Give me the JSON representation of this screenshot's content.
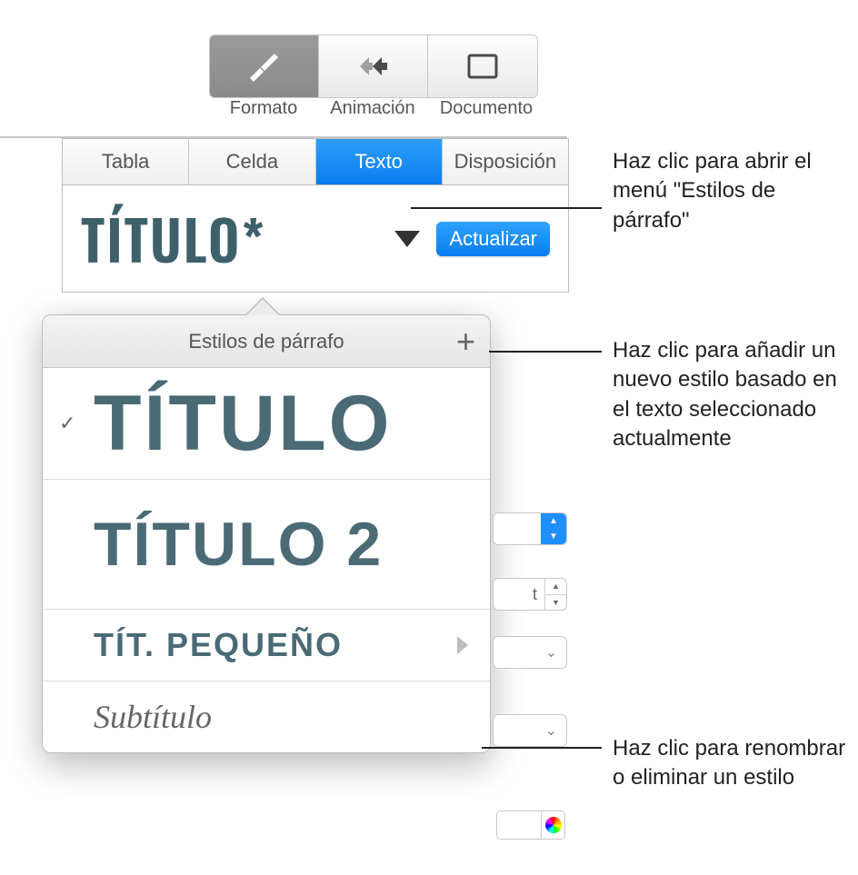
{
  "toolbar": {
    "items": [
      {
        "id": "formato",
        "label": "Formato",
        "active": true
      },
      {
        "id": "animacion",
        "label": "Animación",
        "active": false
      },
      {
        "id": "documento",
        "label": "Documento",
        "active": false
      }
    ]
  },
  "tabs": [
    {
      "id": "tabla",
      "label": "Tabla",
      "active": false
    },
    {
      "id": "celda",
      "label": "Celda",
      "active": false
    },
    {
      "id": "texto",
      "label": "Texto",
      "active": true
    },
    {
      "id": "disposicion",
      "label": "Disposición",
      "active": false
    }
  ],
  "paragraph_style": {
    "current_name": "Título",
    "modified_marker": "*",
    "update_button": "Actualizar"
  },
  "popover": {
    "title": "Estilos de párrafo",
    "add_icon": "+",
    "items": [
      {
        "id": "titulo",
        "label": "Título",
        "selected": true,
        "family": "condensed-xl"
      },
      {
        "id": "titulo2",
        "label": "Título 2",
        "selected": false,
        "family": "condensed-lg"
      },
      {
        "id": "pequeno",
        "label": "Tít. pequeño",
        "selected": false,
        "family": "condensed-sm",
        "has_submenu": true
      },
      {
        "id": "subtitulo",
        "label": "Subtítulo",
        "selected": false,
        "family": "serif-italic"
      }
    ]
  },
  "peek_controls": {
    "size_value": "t",
    "size_unit_suffix": ""
  },
  "callouts": {
    "open_menu": "Haz clic para abrir el menú \"Estilos de párrafo\"",
    "add_style": "Haz clic para añadir un nuevo estilo basado en el texto seleccionado actualmente",
    "rename": "Haz clic para renombrar o eliminar un estilo"
  },
  "colors": {
    "accent_blue": "#0a7df0",
    "heading_teal": "#3e606b"
  }
}
